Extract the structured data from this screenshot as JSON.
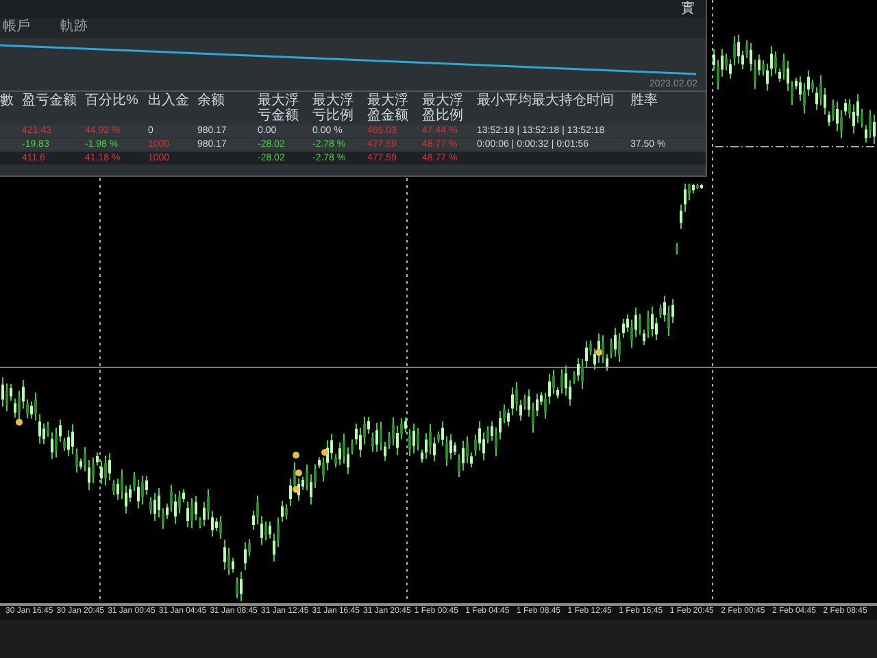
{
  "panel": {
    "title": "實",
    "tabs": [
      {
        "label": "帳戶",
        "selected": false
      },
      {
        "label": "軌跡",
        "selected": false
      }
    ],
    "equity_date": "2023.02.02",
    "table": {
      "columns": [
        "數",
        "盈亏金额",
        "百分比%",
        "出入金",
        "余额",
        "最大浮亏金额",
        "最大浮亏比例",
        "最大浮盈金额",
        "最大浮盈比例",
        "最小平均最大持仓时间",
        "胜率"
      ],
      "rows": [
        {
          "highlight": false,
          "cells": [
            null,
            {
              "text": "421.43",
              "color": "#e0303a"
            },
            {
              "text": "44.92 %",
              "color": "#e0303a"
            },
            {
              "text": "0",
              "color": "#cfd6dc"
            },
            {
              "text": "980.17",
              "color": "#cfd6dc"
            },
            {
              "text": "0.00",
              "color": "#cfd6dc"
            },
            {
              "text": "0.00 %",
              "color": "#cfd6dc"
            },
            {
              "text": "465.03",
              "color": "#e0303a"
            },
            {
              "text": "47.44 %",
              "color": "#e0303a"
            },
            {
              "text": "13:52:18 | 13:52:18 | 13:52:18",
              "color": "#cfd6dc"
            },
            null
          ]
        },
        {
          "highlight": false,
          "cells": [
            null,
            {
              "text": "-19.83",
              "color": "#3ddc3d"
            },
            {
              "text": "-1.98 %",
              "color": "#3ddc3d"
            },
            {
              "text": "1000",
              "color": "#e0303a"
            },
            {
              "text": "980.17",
              "color": "#cfd6dc"
            },
            {
              "text": "-28.02",
              "color": "#3ddc3d"
            },
            {
              "text": "-2.78 %",
              "color": "#3ddc3d"
            },
            {
              "text": "477.59",
              "color": "#e0303a"
            },
            {
              "text": "48.77 %",
              "color": "#e0303a"
            },
            {
              "text": "0:00:06 | 0:00:32 | 0:01:56",
              "color": "#cfd6dc"
            },
            {
              "text": "37.50 %",
              "color": "#cfd6dc"
            }
          ]
        },
        {
          "highlight": true,
          "cells": [
            null,
            {
              "text": "411.6",
              "color": "#e0303a"
            },
            {
              "text": "41.18 %",
              "color": "#e0303a"
            },
            {
              "text": "1000",
              "color": "#e0303a"
            },
            null,
            {
              "text": "-28.02",
              "color": "#3ddc3d"
            },
            {
              "text": "-2.78 %",
              "color": "#3ddc3d"
            },
            {
              "text": "477.59",
              "color": "#e0303a"
            },
            {
              "text": "48.77 %",
              "color": "#e0303a"
            },
            null,
            null
          ]
        }
      ]
    }
  },
  "time_axis": [
    "30 Jan 16:45",
    "30 Jan 20:45",
    "31 Jan 00:45",
    "31 Jan 04:45",
    "31 Jan 08:45",
    "31 Jan 12:45",
    "31 Jan 16:45",
    "31 Jan 20:45",
    "1 Feb 00:45",
    "1 Feb 04:45",
    "1 Feb 08:45",
    "1 Feb 12:45",
    "1 Feb 16:45",
    "1 Feb 20:45",
    "2 Feb 00:45",
    "2 Feb 04:45",
    "2 Feb 08:45"
  ]
}
